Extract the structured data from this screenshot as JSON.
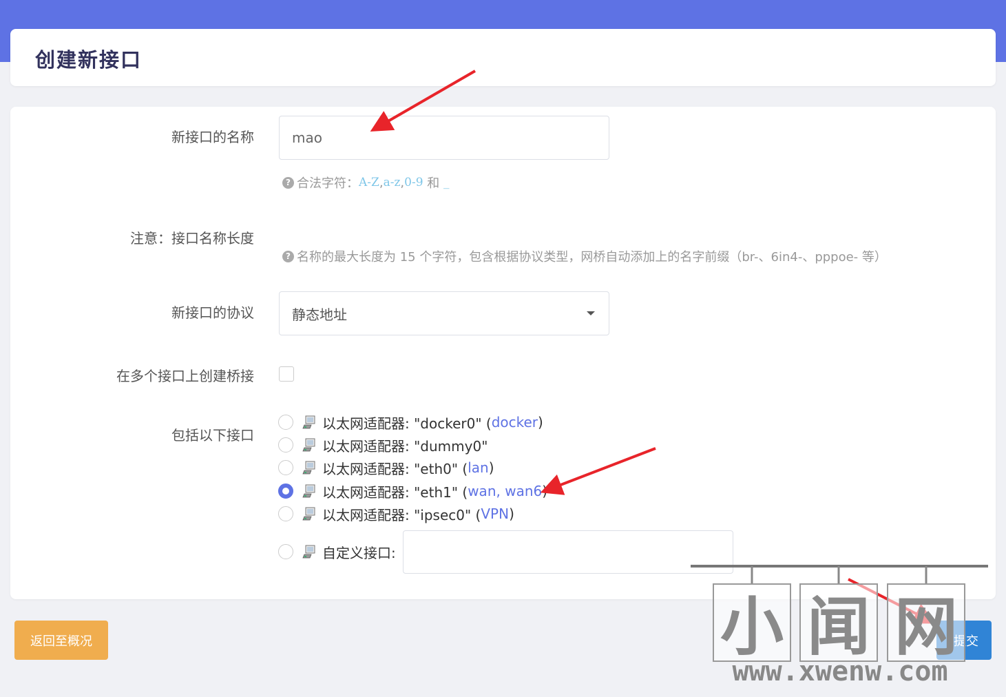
{
  "page": {
    "title": "创建新接口"
  },
  "form": {
    "name": {
      "label": "新接口的名称",
      "value": "mao",
      "help_prefix": "合法字符：",
      "help_chars_1": "A-Z",
      "sep1": ", ",
      "help_chars_2": "a-z",
      "sep2": ", ",
      "help_chars_3": "0-9",
      "help_and": " 和 ",
      "help_chars_4": "_"
    },
    "note": {
      "label": "注意：接口名称长度",
      "help": "名称的最大长度为 15 个字符，包含根据协议类型，网桥自动添加上的名字前缀（br-、6in4-、pppoe- 等）"
    },
    "protocol": {
      "label": "新接口的协议",
      "selected": "静态地址"
    },
    "bridge": {
      "label": "在多个接口上创建桥接",
      "checked": false
    },
    "interfaces": {
      "label": "包括以下接口",
      "items": [
        {
          "prefix": "以太网适配器: \"docker0\" (",
          "networks": "docker",
          "suffix": ")",
          "selected": false
        },
        {
          "prefix": "以太网适配器: \"dummy0\"",
          "networks": "",
          "suffix": "",
          "selected": false
        },
        {
          "prefix": "以太网适配器: \"eth0\" (",
          "networks": "lan",
          "suffix": ")",
          "selected": false
        },
        {
          "prefix": "以太网适配器: \"eth1\" (",
          "networks": "wan, wan6",
          "suffix": ")",
          "selected": true
        },
        {
          "prefix": "以太网适配器: \"ipsec0\" (",
          "networks": "VPN",
          "suffix": ")",
          "selected": false
        }
      ],
      "custom_label": "自定义接口:",
      "custom_value": ""
    }
  },
  "actions": {
    "back_label": "返回至概况",
    "submit_label": "提交"
  },
  "watermark": {
    "chars": [
      "小",
      "闻",
      "网"
    ],
    "url": "www.xwenw.com"
  },
  "colors": {
    "accent": "#5e72e4",
    "warning": "#f0ad4e",
    "primary": "#3084d6",
    "annotation_arrow": "#e8242a"
  },
  "icons": {
    "help": "question-circle-icon",
    "ethernet": "ethernet-adapter-icon",
    "dropdown": "caret-down-icon"
  }
}
